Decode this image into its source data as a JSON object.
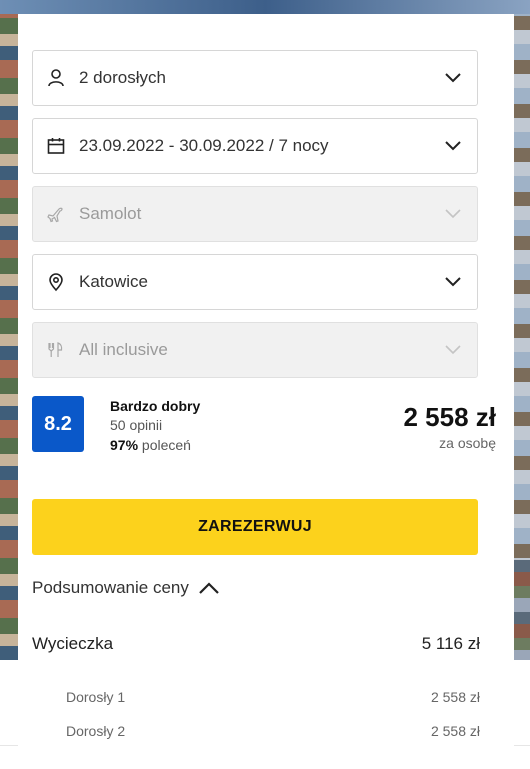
{
  "colors": {
    "accent_yellow": "#fcd21c",
    "rating_blue": "#0a58c9",
    "border": "#d6d6d6",
    "disabled_bg": "#f1f1f1"
  },
  "fields": [
    {
      "label": "2 dorosłych",
      "icon": "person-icon",
      "disabled": false
    },
    {
      "label": "23.09.2022 - 30.09.2022 / 7 nocy",
      "icon": "calendar-icon",
      "disabled": false
    },
    {
      "label": "Samolot",
      "icon": "plane-icon",
      "disabled": true
    },
    {
      "label": "Katowice",
      "icon": "location-pin-icon",
      "disabled": false
    },
    {
      "label": "All inclusive",
      "icon": "cutlery-icon",
      "disabled": true
    }
  ],
  "rating": {
    "score": "8.2",
    "title": "Bardzo dobry",
    "opinions": "50 opinii",
    "recommend_percent": "97%",
    "recommend_label": "poleceń"
  },
  "price": {
    "amount": "2 558 zł",
    "per": "za osobę"
  },
  "book_button": "ZAREZERWUJ",
  "summary": {
    "toggle_label": "Podsumowanie ceny",
    "trip_label": "Wycieczka",
    "trip_amount": "5 116 zł",
    "rows": [
      {
        "label": "Dorosły 1",
        "amount": "2 558 zł"
      },
      {
        "label": "Dorosły 2",
        "amount": "2 558 zł"
      }
    ]
  }
}
